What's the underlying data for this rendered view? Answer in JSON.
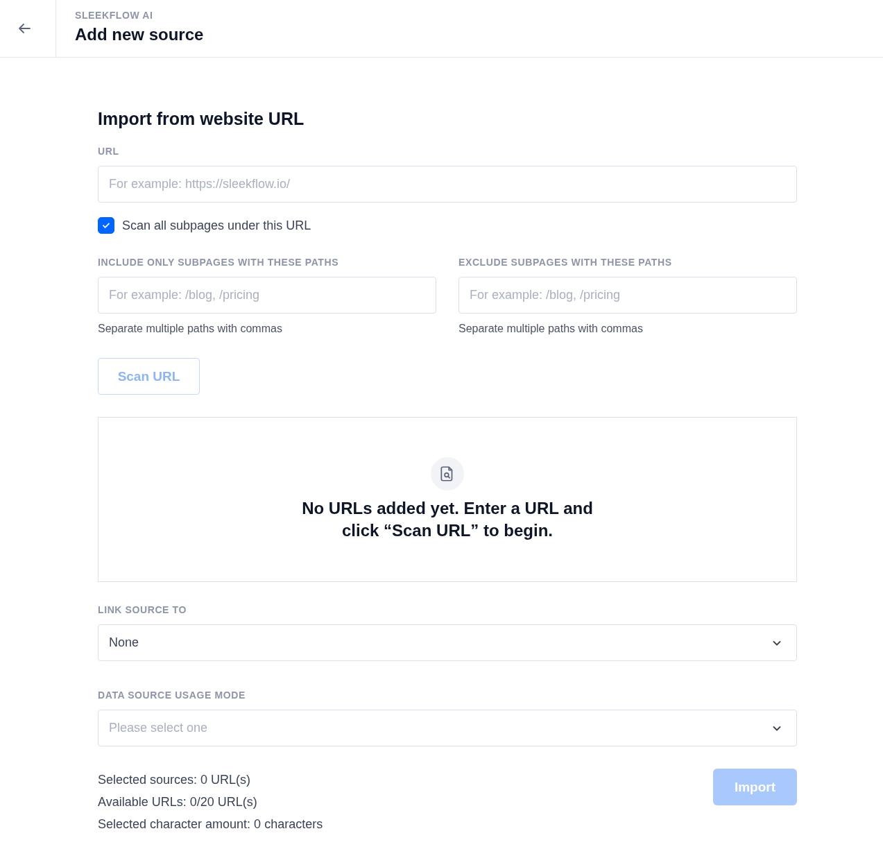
{
  "header": {
    "eyebrow": "SLEEKFLOW AI",
    "title": "Add new source"
  },
  "form": {
    "title": "Import from website URL",
    "url": {
      "label": "URL",
      "placeholder": "For example: https://sleekflow.io/"
    },
    "scan_all": {
      "label": "Scan all subpages under this URL",
      "checked": true
    },
    "path_filters": [
      {
        "label": "INCLUDE ONLY SUBPAGES WITH THESE PATHS",
        "placeholder": "For example: /blog, /pricing",
        "hint": "Separate multiple paths with commas"
      },
      {
        "label": "EXCLUDE SUBPAGES WITH THESE PATHS",
        "placeholder": "For example: /blog, /pricing",
        "hint": "Separate multiple paths with commas"
      }
    ],
    "scan_button": {
      "label": "Scan URL",
      "disabled": true
    },
    "empty_state": {
      "message": "No URLs added yet. Enter a URL and click “Scan URL” to begin."
    },
    "selects": [
      {
        "label": "LINK SOURCE TO",
        "value": "None"
      },
      {
        "label": "DATA SOURCE USAGE MODE",
        "placeholder": "Please select one"
      }
    ],
    "summary": [
      "Selected sources: 0 URL(s)",
      "Available URLs: 0/20 URL(s)",
      "Selected character amount: 0 characters"
    ],
    "import_button": {
      "label": "Import",
      "disabled": true
    }
  }
}
